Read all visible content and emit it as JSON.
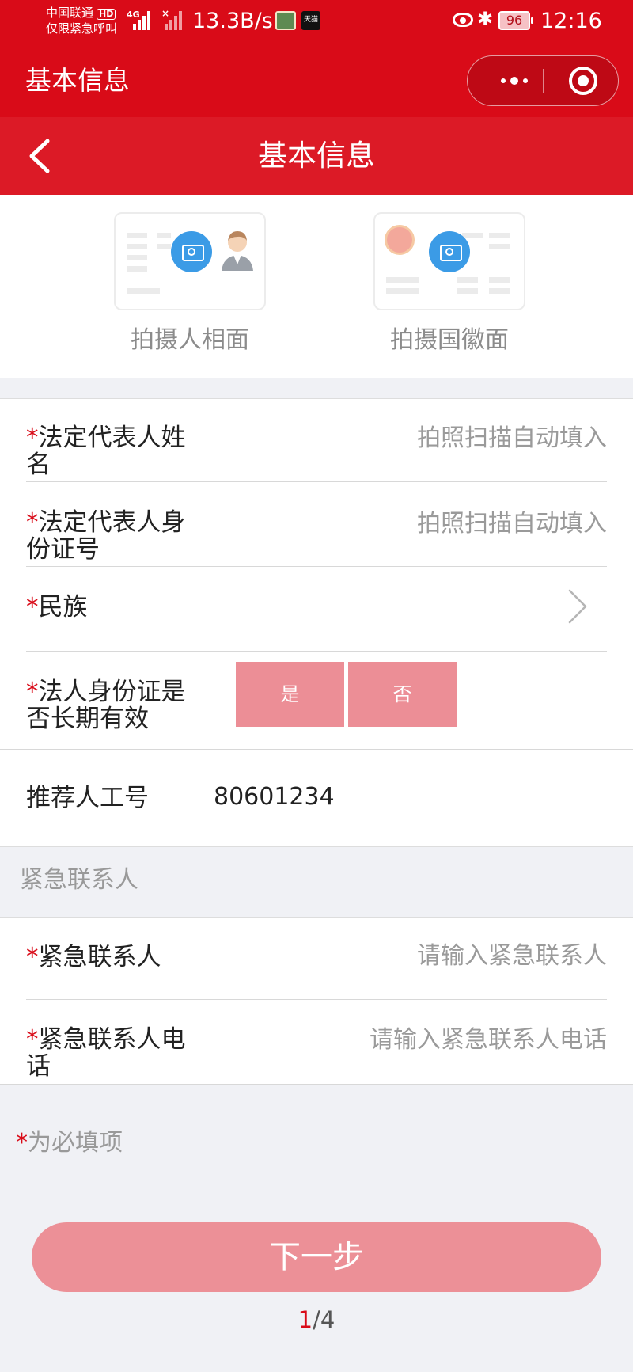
{
  "status_bar": {
    "carrier": "中国联通",
    "hd": "HD",
    "emergency": "仅限紧急呼叫",
    "network": "4G",
    "speed": "13.3B/s",
    "app_badge": "天猫",
    "battery": "96",
    "time": "12:16"
  },
  "titlebar": {
    "title": "基本信息"
  },
  "header": {
    "title": "基本信息"
  },
  "photos": {
    "portrait_label": "拍摄人相面",
    "emblem_label": "拍摄国徽面"
  },
  "form": {
    "legal_name": {
      "star": "*",
      "label": "法定代表人姓名",
      "placeholder": "拍照扫描自动填入"
    },
    "legal_id": {
      "star": "*",
      "label": "法定代表人身份证号",
      "placeholder": "拍照扫描自动填入"
    },
    "ethnicity": {
      "star": "*",
      "label": "民族"
    },
    "id_long_term": {
      "star": "*",
      "label": "法人身份证是否长期有效",
      "yes": "是",
      "no": "否"
    },
    "referrer": {
      "label": "推荐人工号",
      "value": "80601234"
    }
  },
  "emergency_section": {
    "title": "紧急联系人"
  },
  "emergency": {
    "contact": {
      "star": "*",
      "label": "紧急联系人",
      "placeholder": "请输入紧急联系人"
    },
    "phone": {
      "star": "*",
      "label": "紧急联系人电话",
      "placeholder": "请输入紧急联系人电话"
    }
  },
  "note": {
    "star": "*",
    "text": "为必填项"
  },
  "next_button": "下一步",
  "pager": {
    "current": "1",
    "total": "/4"
  },
  "colors": {
    "brand_red": "#d90b18",
    "button_pink": "#ec9097",
    "camera_blue": "#3b9be6"
  }
}
